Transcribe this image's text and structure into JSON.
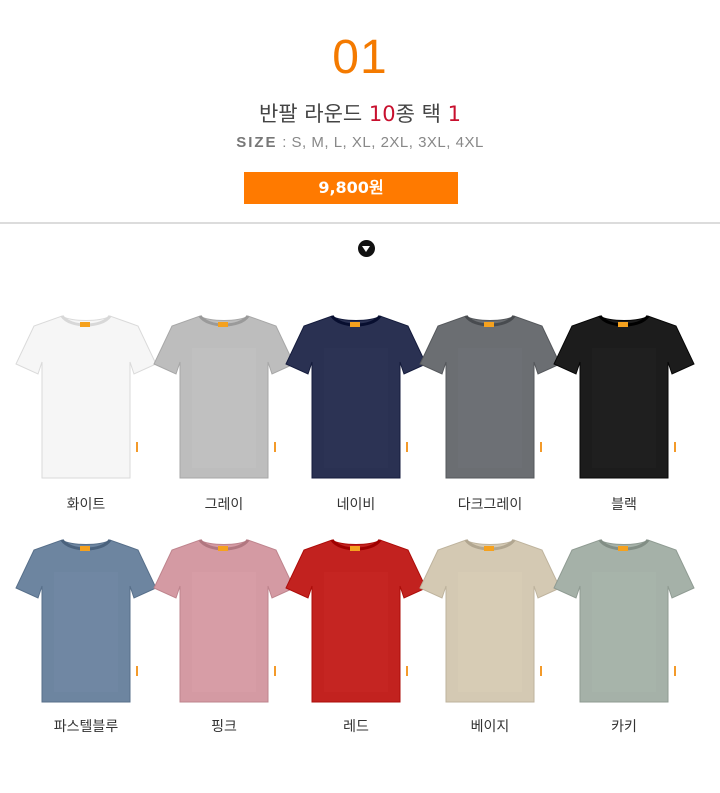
{
  "header": {
    "number": "01",
    "title_prefix": "반팔 라운드 ",
    "title_accent": "10",
    "title_suffix": "종 택 ",
    "title_accent2": "1",
    "size_label": "SIZE",
    "size_values": " : S, M, L, XL, 2XL, 3XL, 4XL",
    "price": "9,800원"
  },
  "colors": {
    "accent": "#f47a00",
    "price_bg": "#ff7a00",
    "title_accent": "#c8102e"
  },
  "products": [
    {
      "name": "화이트",
      "color": "#f6f6f6"
    },
    {
      "name": "그레이",
      "color": "#bdbdbd"
    },
    {
      "name": "네이비",
      "color": "#2a3152"
    },
    {
      "name": "다크그레이",
      "color": "#6b6e72"
    },
    {
      "name": "블랙",
      "color": "#1c1c1c"
    },
    {
      "name": "파스텔블루",
      "color": "#6d85a0"
    },
    {
      "name": "핑크",
      "color": "#d49aa3"
    },
    {
      "name": "레드",
      "color": "#c2221f"
    },
    {
      "name": "베이지",
      "color": "#d4c9b3"
    },
    {
      "name": "카키",
      "color": "#a5b1a8"
    }
  ]
}
